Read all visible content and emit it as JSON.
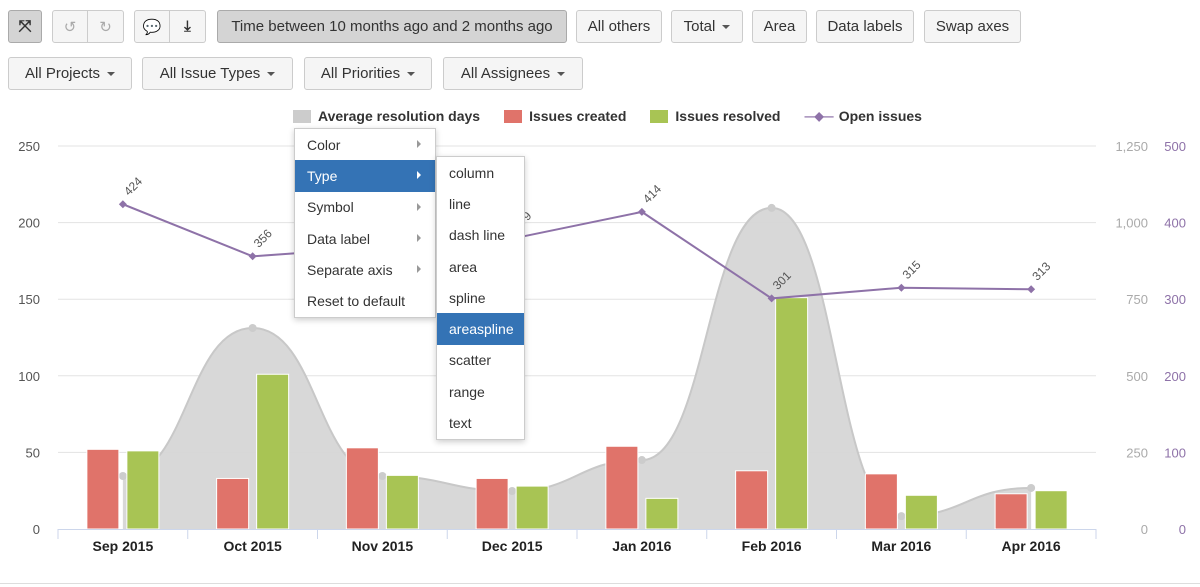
{
  "toolbar": {
    "fullscreen_icon": "fullscreen-icon",
    "undo_icon": "undo-icon",
    "redo_icon": "redo-icon",
    "comment_icon": "comment-icon",
    "download_icon": "download-icon",
    "time_filter": "Time between 10 months ago and 2 months ago",
    "all_others": "All others",
    "total": "Total",
    "area": "Area",
    "data_labels": "Data labels",
    "swap_axes": "Swap axes"
  },
  "filters": {
    "projects": "All Projects",
    "issue_types": "All Issue Types",
    "priorities": "All Priorities",
    "assignees": "All Assignees"
  },
  "context_menu": {
    "items": [
      "Color",
      "Type",
      "Symbol",
      "Data label",
      "Separate axis",
      "Reset to default"
    ],
    "selected": "Type",
    "submenu": [
      "column",
      "line",
      "dash line",
      "area",
      "spline",
      "areaspline",
      "scatter",
      "range",
      "text"
    ],
    "submenu_selected": "areaspline"
  },
  "chart_data": {
    "type": "bar",
    "categories": [
      "Sep 2015",
      "Oct 2015",
      "Nov 2015",
      "Dec 2015",
      "Jan 2016",
      "Feb 2016",
      "Mar 2016",
      "Apr 2016"
    ],
    "left_axis": {
      "range": [
        0,
        250
      ],
      "ticks": [
        "0",
        "50",
        "100",
        "150",
        "200",
        "250"
      ]
    },
    "right_axis_1": {
      "range": [
        0,
        1250
      ],
      "ticks": [
        "0",
        "250",
        "500",
        "750",
        "1,000",
        "1,250"
      ],
      "color": "#aaaaaa"
    },
    "right_axis_2": {
      "range": [
        0,
        500
      ],
      "ticks": [
        "0",
        "100",
        "200",
        "300",
        "400",
        "500"
      ],
      "color": "#8e72a8"
    },
    "grid": true,
    "legend_position": "top",
    "series": [
      {
        "name": "Average resolution days",
        "type": "areaspline",
        "axis": "right_axis_1",
        "color": "#d4d4d4",
        "values": [
          173,
          656,
          173,
          124,
          225,
          1048,
          42,
          134
        ]
      },
      {
        "name": "Issues created",
        "type": "column",
        "axis": "left",
        "color": "#e0736a",
        "values": [
          52,
          33,
          53,
          33,
          54,
          38,
          36,
          23
        ]
      },
      {
        "name": "Issues resolved",
        "type": "column",
        "axis": "left",
        "color": "#a8c454",
        "values": [
          51,
          101,
          35,
          28,
          20,
          151,
          22,
          25
        ]
      },
      {
        "name": "Open issues",
        "type": "line",
        "axis": "right_axis_2",
        "color": "#8e72a8",
        "values": [
          424,
          356,
          368,
          379,
          414,
          301,
          315,
          313
        ],
        "labels": [
          "424",
          "356",
          "",
          "379",
          "414",
          "301",
          "315",
          "313"
        ]
      }
    ]
  }
}
